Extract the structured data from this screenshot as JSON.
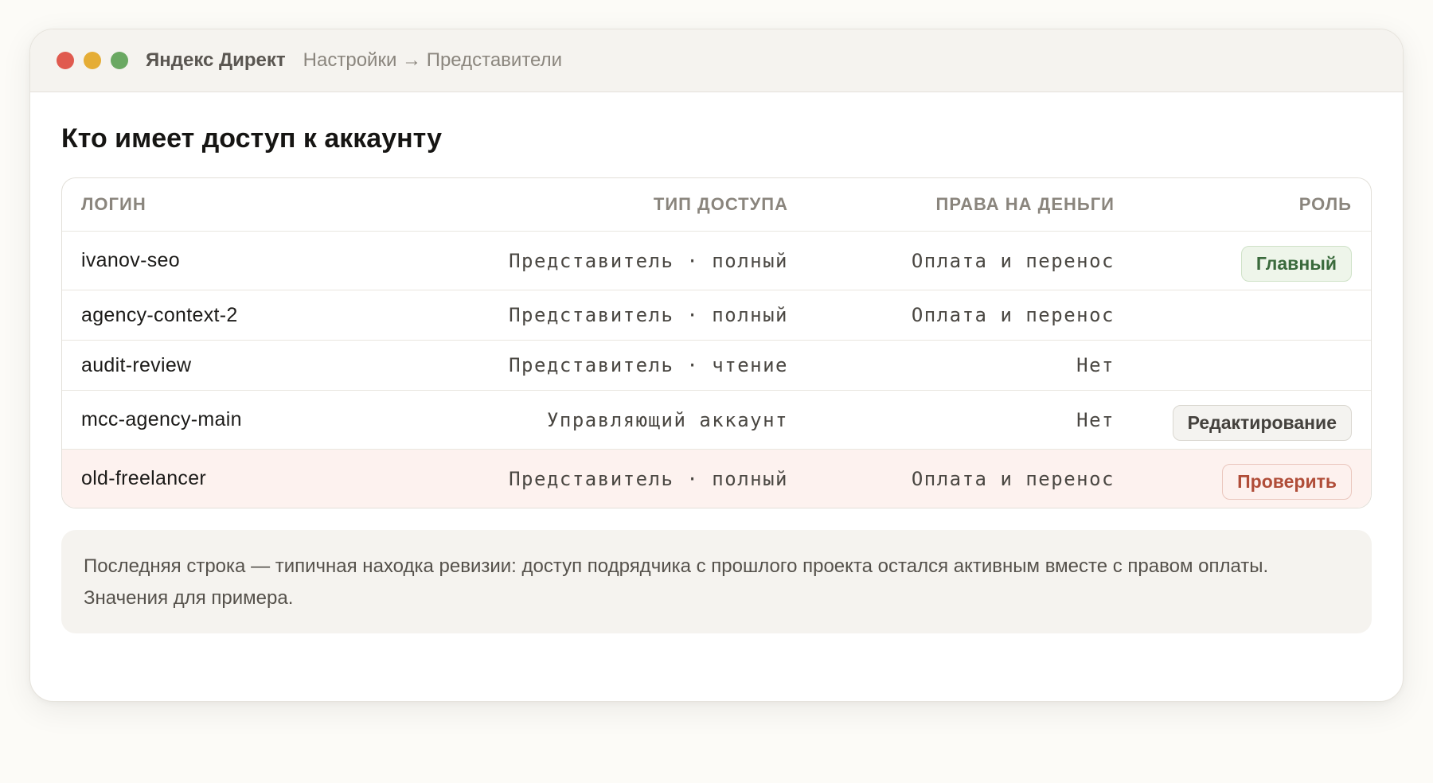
{
  "window": {
    "app_name": "Яндекс Директ",
    "breadcrumb": "Настройки → Представители"
  },
  "page": {
    "title": "Кто имеет доступ к аккаунту"
  },
  "table": {
    "headers": {
      "login": "ЛОГИН",
      "access_type": "ТИП ДОСТУПА",
      "money_rights": "ПРАВА НА ДЕНЬГИ",
      "role": "РОЛЬ"
    },
    "rows": [
      {
        "login": "ivanov-seo",
        "access_type": "Представитель · полный",
        "money_rights": "Оплата и перенос",
        "role": "Главный",
        "role_style": "green",
        "flagged": false
      },
      {
        "login": "agency-context-2",
        "access_type": "Представитель · полный",
        "money_rights": "Оплата и перенос",
        "role": "",
        "role_style": "",
        "flagged": false
      },
      {
        "login": "audit-review",
        "access_type": "Представитель · чтение",
        "money_rights": "Нет",
        "role": "",
        "role_style": "",
        "flagged": false
      },
      {
        "login": "mcc-agency-main",
        "access_type": "Управляющий аккаунт",
        "money_rights": "Нет",
        "role": "Редактирование",
        "role_style": "gray",
        "flagged": false
      },
      {
        "login": "old-freelancer",
        "access_type": "Представитель · полный",
        "money_rights": "Оплата и перенос",
        "role": "Проверить",
        "role_style": "red",
        "flagged": true
      }
    ]
  },
  "note": {
    "text": "Последняя строка — типичная находка ревизии: доступ подрядчика с прошлого проекта остался активным вместе с правом оплаты. Значения для примера."
  },
  "colors": {
    "window_close": "#e05a4f",
    "window_minimize": "#e5ad36",
    "window_maximize": "#6aa862",
    "flagged_row_bg": "#fdf2ef",
    "badge_green_text": "#3a6a3c",
    "badge_red_text": "#b04d38"
  }
}
